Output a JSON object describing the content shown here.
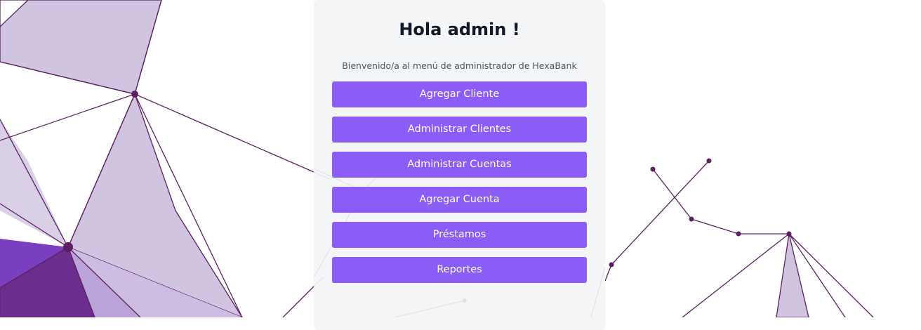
{
  "theme": {
    "accent": "#8b5cf6",
    "card_background": "#f3f4f6",
    "poly_light": "#d1c4e0",
    "poly_mid": "#b9a3d8",
    "poly_dark": "#6b2d8e",
    "line_color": "#5b1f62"
  },
  "header": {
    "title": "Hola admin !",
    "subtitle": "Bienvenido/a al menú de administrador de HexaBank"
  },
  "menu": {
    "items": [
      {
        "label": "Agregar Cliente"
      },
      {
        "label": "Administrar Clientes"
      },
      {
        "label": "Administrar Cuentas"
      },
      {
        "label": "Agregar Cuenta"
      },
      {
        "label": "Préstamos"
      },
      {
        "label": "Reportes"
      }
    ]
  }
}
